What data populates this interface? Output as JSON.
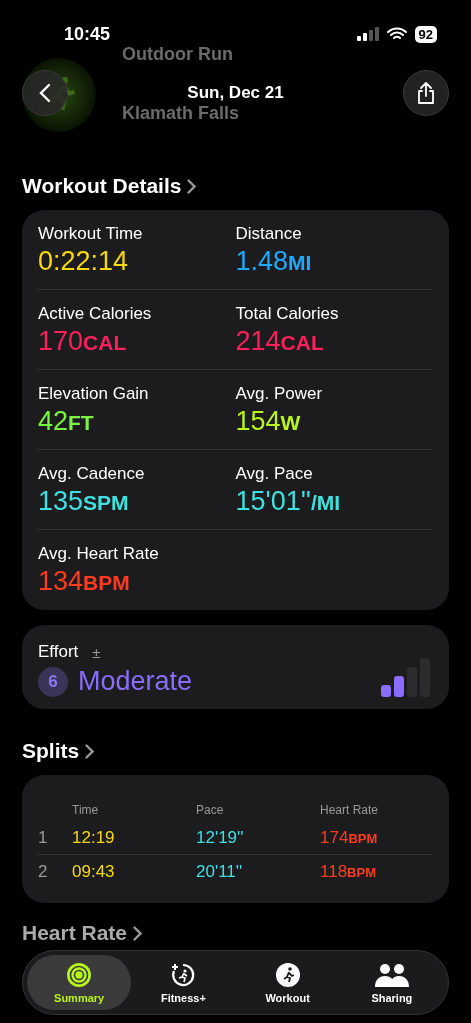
{
  "status_bar": {
    "time": "10:45",
    "battery": "92"
  },
  "header": {
    "title": "Sun, Dec 21",
    "behind": {
      "workout": "Outdoor Run",
      "location": "Klamath Falls"
    }
  },
  "details": {
    "heading": "Workout Details",
    "metrics": [
      {
        "label": "Workout Time",
        "value": "0:22:14",
        "color": "#f5d90a"
      },
      {
        "label": "Distance",
        "value": "1.48",
        "unit": "MI",
        "color": "#1fa8ff"
      },
      {
        "label": "Active Calories",
        "value": "170",
        "unit": "CAL",
        "color": "#ff1f5a"
      },
      {
        "label": "Total Calories",
        "value": "214",
        "unit": "CAL",
        "color": "#ff1f5a"
      },
      {
        "label": "Elevation Gain",
        "value": "42",
        "unit": "FT",
        "color": "#7cf542"
      },
      {
        "label": "Avg. Power",
        "value": "154",
        "unit": "W",
        "color": "#b8f51a"
      },
      {
        "label": "Avg. Cadence",
        "value": "135",
        "unit": "SPM",
        "color": "#3fe0e0"
      },
      {
        "label": "Avg. Pace",
        "value": "15'01''",
        "unit": "/MI",
        "color": "#3fe0e0"
      },
      {
        "label": "Avg. Heart Rate",
        "value": "134",
        "unit": "BPM",
        "color": "#ff3b20"
      }
    ]
  },
  "effort": {
    "label": "Effort",
    "adjust": "±",
    "score": "6",
    "rating": "Moderate",
    "level": 0.5
  },
  "splits": {
    "heading": "Splits",
    "columns": [
      "Time",
      "Pace",
      "Heart Rate"
    ],
    "rows": [
      {
        "index": "1",
        "time": "12:19",
        "pace": "12'19''",
        "heart_rate": "174",
        "unit": "BPM"
      },
      {
        "index": "2",
        "time": "09:43",
        "pace": "20'11''",
        "heart_rate": "118",
        "unit": "BPM"
      }
    ]
  },
  "next_heading": "Heart Rate",
  "tabs": [
    {
      "label": "Summary",
      "kind": "rings",
      "selected": true
    },
    {
      "label": "Fitness+",
      "kind": "fitness",
      "selected": false
    },
    {
      "label": "Workout",
      "kind": "runner",
      "selected": false
    },
    {
      "label": "Sharing",
      "kind": "people",
      "selected": false
    }
  ]
}
